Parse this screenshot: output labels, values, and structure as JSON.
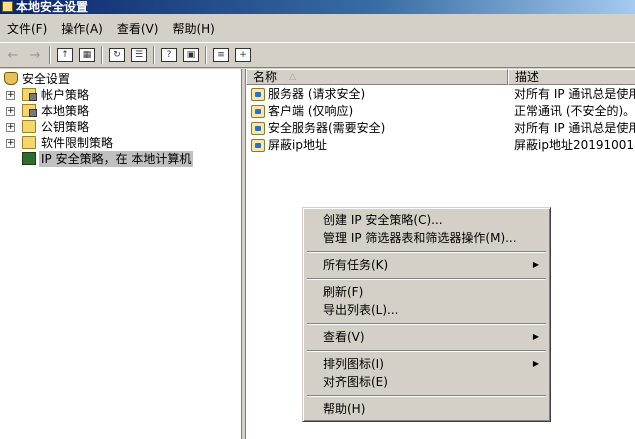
{
  "window": {
    "title": "本地安全设置"
  },
  "menubar": [
    {
      "label": "文件(F)"
    },
    {
      "label": "操作(A)"
    },
    {
      "label": "查看(V)"
    },
    {
      "label": "帮助(H)"
    }
  ],
  "toolbar": {
    "buttons": [
      {
        "icon": "back-arrow-icon"
      },
      {
        "icon": "forward-arrow-icon"
      },
      {
        "icon": "up-folder-icon"
      },
      {
        "icon": "show-hide-tree-icon"
      },
      {
        "icon": "refresh-icon"
      },
      {
        "icon": "export-list-icon"
      },
      {
        "icon": "help-icon"
      },
      {
        "icon": "properties-icon"
      },
      {
        "icon": "manage-filters-icon"
      },
      {
        "icon": "add-policy-icon"
      }
    ]
  },
  "tree": {
    "root": "安全设置",
    "items": [
      {
        "label": "帐户策略",
        "icon": "folder-lock-icon"
      },
      {
        "label": "本地策略",
        "icon": "folder-lock-icon"
      },
      {
        "label": "公钥策略",
        "icon": "folder-icon"
      },
      {
        "label": "软件限制策略",
        "icon": "folder-icon"
      },
      {
        "label": "IP 安全策略，在 本地计算机",
        "icon": "computer-icon"
      }
    ]
  },
  "list": {
    "columns": {
      "name": "名称",
      "description": "描述"
    },
    "rows": [
      {
        "name": "服务器 (请求安全)",
        "description": "对所有 IP 通讯总是使用"
      },
      {
        "name": "客户端 (仅响应)",
        "description": "正常通讯 (不安全的)。"
      },
      {
        "name": "安全服务器(需要安全)",
        "description": "对所有 IP 通讯总是使用"
      },
      {
        "name": "屏蔽ip地址",
        "description": "屏蔽ip地址20191001"
      }
    ]
  },
  "context_menu": {
    "create_policy": "创建 IP 安全策略(C)...",
    "manage_filters": "管理 IP 筛选器表和筛选器操作(M)...",
    "all_tasks": "所有任务(K)",
    "refresh": "刷新(F)",
    "export_list": "导出列表(L)...",
    "view": "查看(V)",
    "arrange_icons": "排列图标(I)",
    "align_icons": "对齐图标(E)",
    "help": "帮助(H)"
  }
}
